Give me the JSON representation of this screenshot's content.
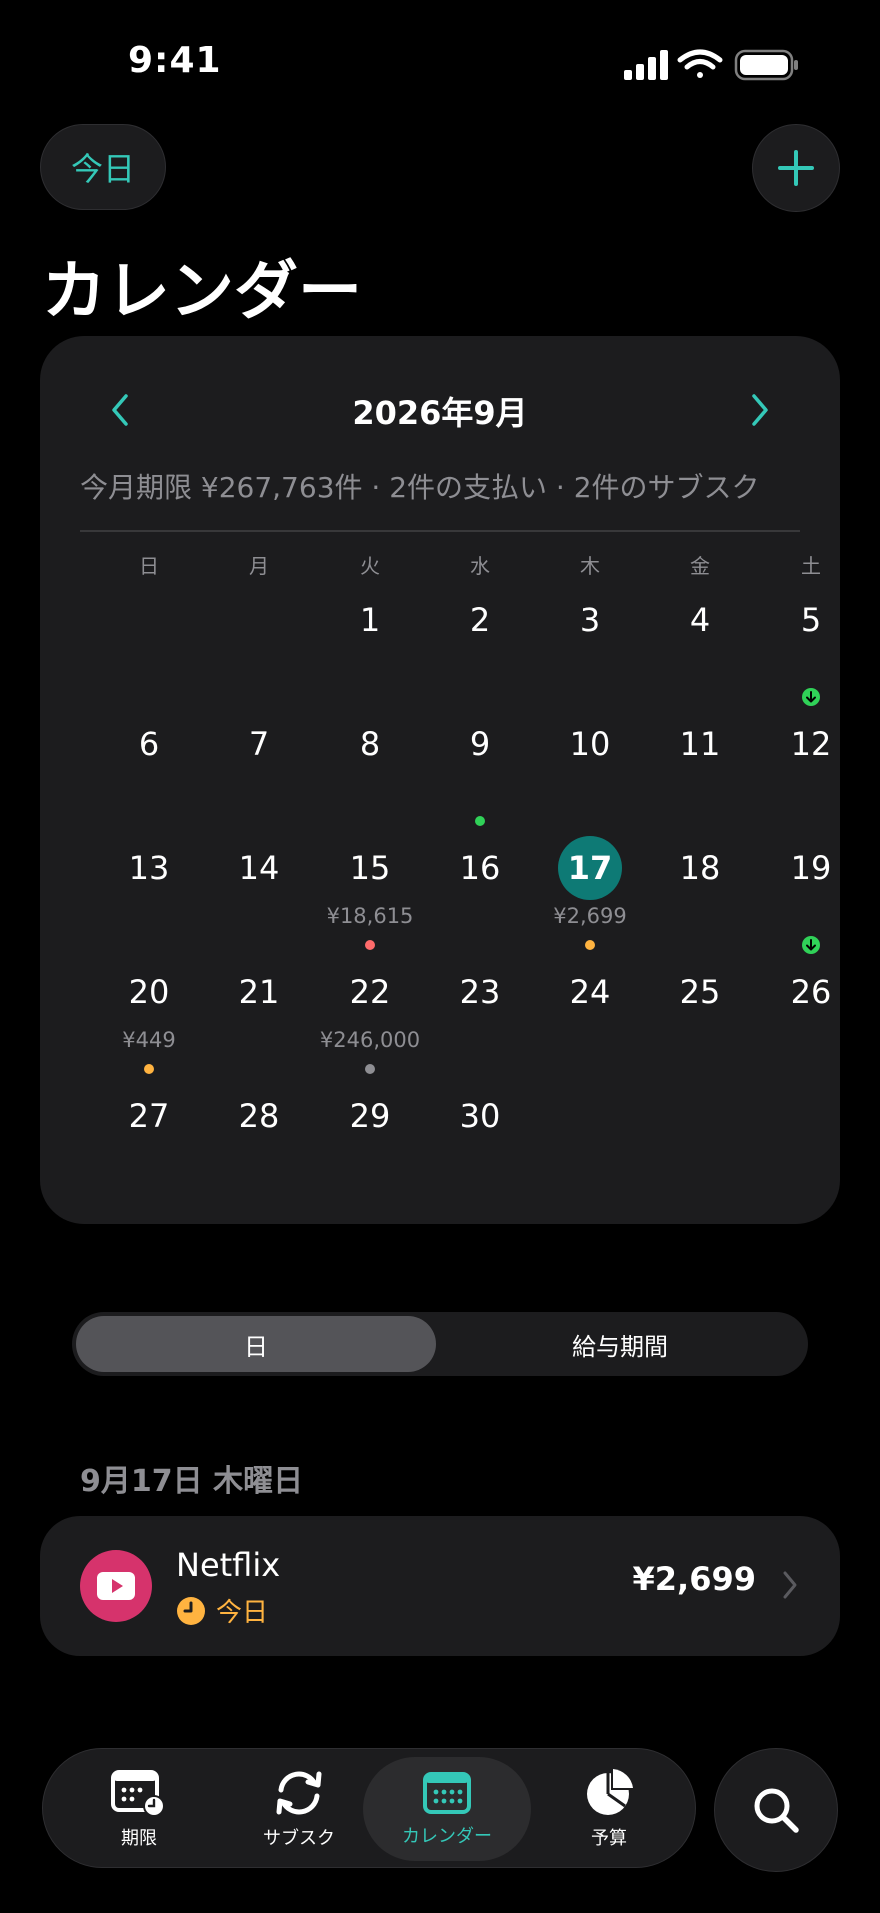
{
  "status_bar": {
    "time": "9:41"
  },
  "header": {
    "today_label": "今日",
    "title": "カレンダー"
  },
  "calendar": {
    "month_title": "2026年9月",
    "summary": "今月期限 ¥267,763件 · 2件の支払い · 2件のサブスク",
    "weekdays": [
      "日",
      "月",
      "火",
      "水",
      "木",
      "金",
      "土"
    ],
    "days": [
      {
        "n": "1"
      },
      {
        "n": "2"
      },
      {
        "n": "3"
      },
      {
        "n": "4"
      },
      {
        "n": "5"
      },
      {
        "n": "6"
      },
      {
        "n": "7"
      },
      {
        "n": "8"
      },
      {
        "n": "9"
      },
      {
        "n": "10"
      },
      {
        "n": "11"
      },
      {
        "n": "12"
      },
      {
        "n": "13"
      },
      {
        "n": "14"
      },
      {
        "n": "15",
        "amount": "¥18,615"
      },
      {
        "n": "16"
      },
      {
        "n": "17",
        "amount": "¥2,699"
      },
      {
        "n": "18"
      },
      {
        "n": "19"
      },
      {
        "n": "20",
        "amount": "¥449"
      },
      {
        "n": "21"
      },
      {
        "n": "22",
        "amount": "¥246,000"
      },
      {
        "n": "23"
      },
      {
        "n": "24"
      },
      {
        "n": "25"
      },
      {
        "n": "26"
      },
      {
        "n": "27"
      },
      {
        "n": "28"
      },
      {
        "n": "29"
      },
      {
        "n": "30"
      }
    ],
    "colors": {
      "accent": "#34c8b8",
      "today_bg": "#0e7a75",
      "red": "#ff6b6b",
      "orange": "#ffb340",
      "gray": "#8e8e93",
      "green": "#30d158"
    }
  },
  "segmented": {
    "day_label": "日",
    "pay_period_label": "給与期間"
  },
  "selected_date": "9月17日 木曜日",
  "items": [
    {
      "name": "Netflix",
      "due": "今日",
      "amount": "¥2,699",
      "icon": "play-icon"
    }
  ],
  "tabs": [
    {
      "label": "期限",
      "icon": "calendar-clock-icon"
    },
    {
      "label": "サブスク",
      "icon": "refresh-icon"
    },
    {
      "label": "カレンダー",
      "icon": "calendar-icon"
    },
    {
      "label": "予算",
      "icon": "pie-chart-icon"
    }
  ]
}
